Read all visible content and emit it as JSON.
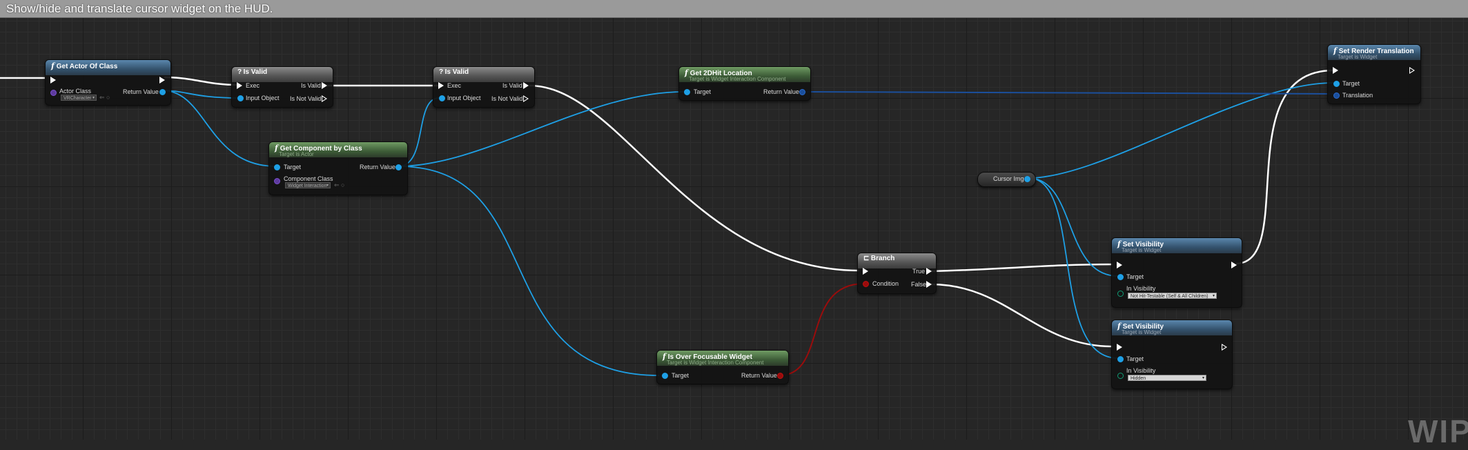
{
  "comment": {
    "title": "Show/hide and translate cursor widget on the HUD."
  },
  "colors": {
    "exec_wire": "#ffffff",
    "object_wire": "#1ea0e6",
    "bool_wire": "#9a0c0c",
    "vector_wire": "#1b4f9c"
  },
  "nodes": {
    "get_actor_of_class": {
      "title": "Get Actor Of Class",
      "pin_actor_class": "Actor Class",
      "actor_class_value": "VRCharacter",
      "pin_return": "Return Value"
    },
    "is_valid_1": {
      "title": "Is Valid",
      "pin_exec": "Exec",
      "pin_input": "Input Object",
      "pin_is_valid": "Is Valid",
      "pin_is_not_valid": "Is Not Valid"
    },
    "is_valid_2": {
      "title": "Is Valid",
      "pin_exec": "Exec",
      "pin_input": "Input Object",
      "pin_is_valid": "Is Valid",
      "pin_is_not_valid": "Is Not Valid"
    },
    "get_component_by_class": {
      "title": "Get Component by Class",
      "subtitle": "Target is Actor",
      "pin_target": "Target",
      "pin_component_class": "Component Class",
      "component_class_value": "Widget Interaction",
      "pin_return": "Return Value"
    },
    "get_2d_hit_location": {
      "title": "Get 2DHit Location",
      "subtitle": "Target is Widget Interaction Component",
      "pin_target": "Target",
      "pin_return": "Return Value"
    },
    "set_render_translation": {
      "title": "Set Render Translation",
      "subtitle": "Target is Widget",
      "pin_target": "Target",
      "pin_translation": "Translation"
    },
    "cursor_img": {
      "label": "Cursor Img"
    },
    "branch": {
      "title": "Branch",
      "pin_condition": "Condition",
      "pin_true": "True",
      "pin_false": "False"
    },
    "set_visibility_1": {
      "title": "Set Visibility",
      "subtitle": "Target is Widget",
      "pin_target": "Target",
      "pin_in_visibility": "In Visibility",
      "visibility_value": "Not Hit-Testable (Self & All Children)"
    },
    "set_visibility_2": {
      "title": "Set Visibility",
      "subtitle": "Target is Widget",
      "pin_target": "Target",
      "pin_in_visibility": "In Visibility",
      "visibility_value": "Hidden"
    },
    "is_over_focusable_widget": {
      "title": "Is Over Focusable Widget",
      "subtitle": "Target is Widget Interaction Component",
      "pin_target": "Target",
      "pin_return": "Return Value"
    }
  },
  "watermark": "WIP"
}
